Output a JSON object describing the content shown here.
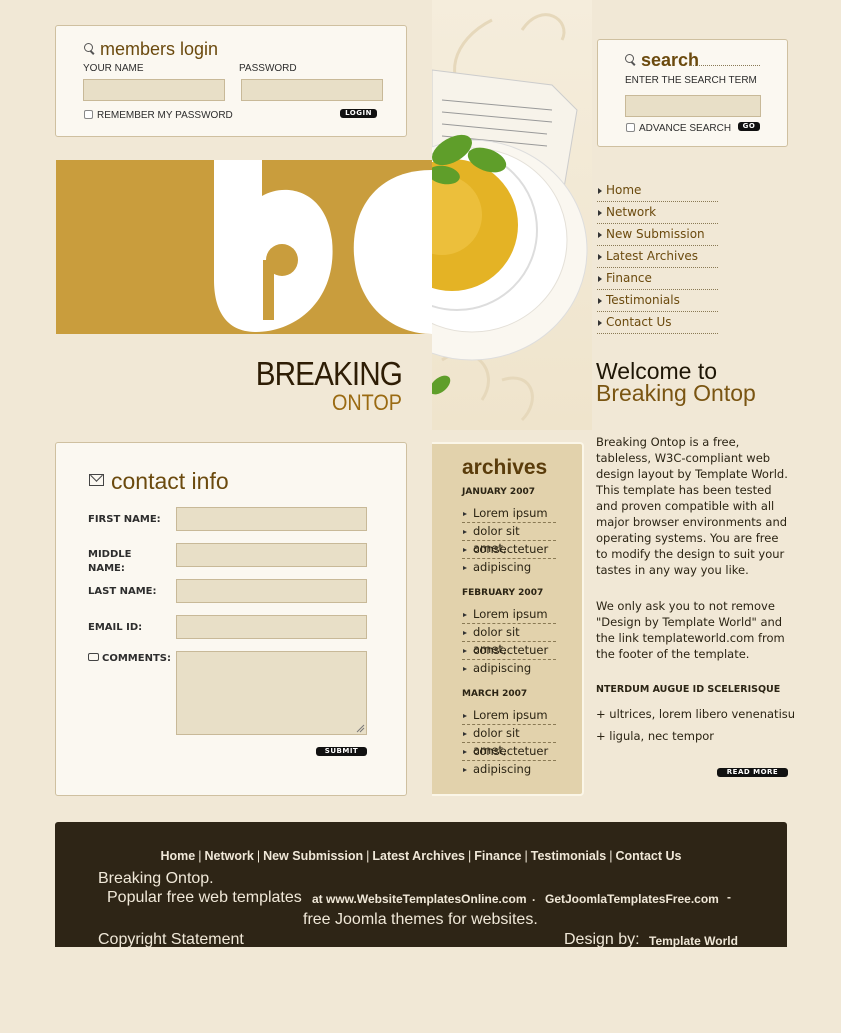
{
  "login": {
    "title": "members login",
    "name_label": "YOUR NAME",
    "password_label": "PASSWORD",
    "remember_label": "REMEMBER MY PASSWORD",
    "login_button": "LOGIN"
  },
  "search": {
    "title": "search",
    "prompt": "ENTER THE SEARCH TERM",
    "advance_label": "ADVANCE SEARCH",
    "go_button": "GO"
  },
  "brand": {
    "line1": "BREAKING",
    "line2": "ONTOP"
  },
  "nav": {
    "items": [
      "Home",
      "Network",
      "New Submission",
      "Latest Archives",
      "Finance",
      "Testimonials",
      "Contact Us"
    ]
  },
  "welcome": {
    "line1": "Welcome to",
    "line2": "Breaking Ontop",
    "para1": "Breaking Ontop is a free, tableless, W3C-compliant web design layout by Template World. This template has been tested and proven compatible with all major browser environments and operating systems. You are free to modify the design to suit your tastes in any way you like.",
    "para2": "We only ask you to not remove \"Design by Template World\" and the link templateworld.com from the footer of the template.",
    "subhead": "NTERDUM AUGUE ID SCELERISQUE",
    "bullets": [
      "+ ultrices, lorem libero venenatisu",
      "+ ligula, nec tempor"
    ],
    "read_more": "READ MORE"
  },
  "contact": {
    "title": "contact info",
    "first_name": "FIRST NAME:",
    "middle_name": "MIDDLE NAME:",
    "last_name": "LAST NAME:",
    "email": "EMAIL ID:",
    "comments": "COMMENTS:",
    "submit": "SUBMIT"
  },
  "archives": {
    "title": "archives",
    "months": [
      {
        "name": "JANUARY 2007",
        "items": [
          "Lorem ipsum",
          "dolor sit amet,",
          "consectetuer",
          "adipiscing"
        ]
      },
      {
        "name": "FEBRUARY 2007",
        "items": [
          "Lorem ipsum",
          "dolor sit amet,",
          "consectetuer",
          "adipiscing"
        ]
      },
      {
        "name": "MARCH 2007",
        "items": [
          "Lorem ipsum",
          "dolor sit amet,",
          "consectetuer",
          "adipiscing"
        ]
      }
    ]
  },
  "footer": {
    "nav": [
      "Home",
      "Network",
      "New Submission",
      "Latest Archives",
      "Finance",
      "Testimonials",
      "Contact Us"
    ],
    "site_name": "Breaking Ontop.",
    "popular": "Popular free web templates",
    "link1": "at www.WebsiteTemplatesOnline.com",
    "dot": ".",
    "link2": "GetJoomlaTemplatesFree.com",
    "dash": "-",
    "joomla": "free Joomla themes for websites.",
    "copyright": "Copyright Statement",
    "design_by": "Design by:",
    "designer": "Template World"
  },
  "colors": {
    "background": "#f1e8d6",
    "accent_gold": "#c99d3d",
    "brown_text": "#6b4a0e",
    "footer": "#2e2516"
  }
}
